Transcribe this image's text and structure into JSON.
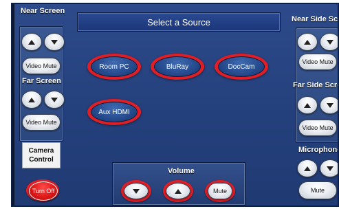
{
  "title": "Select a Source",
  "left_column": {
    "near_screen_label": "Near Screen",
    "near_video_mute": "Video Mute",
    "far_screen_label": "Far Screen",
    "far_video_mute": "Video Mute",
    "camera_control_line1": "Camera",
    "camera_control_line2": "Control",
    "turn_off": "Turn Off"
  },
  "sources": [
    {
      "label": "Room PC"
    },
    {
      "label": "BluRay"
    },
    {
      "label": "DocCam"
    },
    {
      "label": "Aux HDMI"
    }
  ],
  "volume": {
    "label": "Volume",
    "mute": "Mute"
  },
  "right_column": {
    "near_side_label": "Near Side Screen",
    "near_video_mute": "Video Mute",
    "far_side_label": "Far Side Screen",
    "far_video_mute": "Video Mute",
    "microphone_label": "Microphone",
    "mic_mute": "Mute"
  },
  "colors": {
    "panel_blue": "#24407c",
    "highlight_red": "#e01e26",
    "turn_off_red": "#e01818"
  },
  "icons": [
    "arrow-up-icon",
    "arrow-down-icon"
  ]
}
